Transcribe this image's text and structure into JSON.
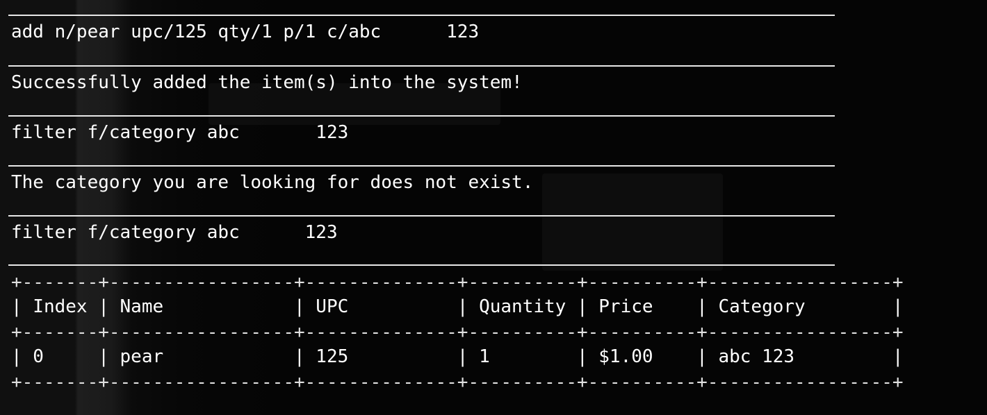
{
  "history": [
    {
      "kind": "command",
      "text": "add n/pear upc/125 qty/1 p/1 c/abc      123"
    },
    {
      "kind": "response",
      "text": "Successfully added the item(s) into the system!"
    },
    {
      "kind": "command",
      "text": "filter f/category abc       123"
    },
    {
      "kind": "response",
      "text": "The category you are looking for does not exist."
    },
    {
      "kind": "command",
      "text": "filter f/category abc      123"
    }
  ],
  "table": {
    "border": "+-------+-----------------+--------------+----------+----------+-----------------+",
    "headers": [
      "Index",
      "Name",
      "UPC",
      "Quantity",
      "Price",
      "Category"
    ],
    "header_line": "| Index | Name            | UPC          | Quantity | Price    | Category        |",
    "rows": [
      {
        "cells": [
          "0",
          "pear",
          "125",
          "1",
          "$1.00",
          "abc 123"
        ],
        "line": "| 0     | pear            | 125          | 1        | $1.00    | abc 123         |"
      }
    ]
  },
  "colors": {
    "background": "#050505",
    "text": "#ffffff",
    "separator": "#e8e8e8"
  }
}
